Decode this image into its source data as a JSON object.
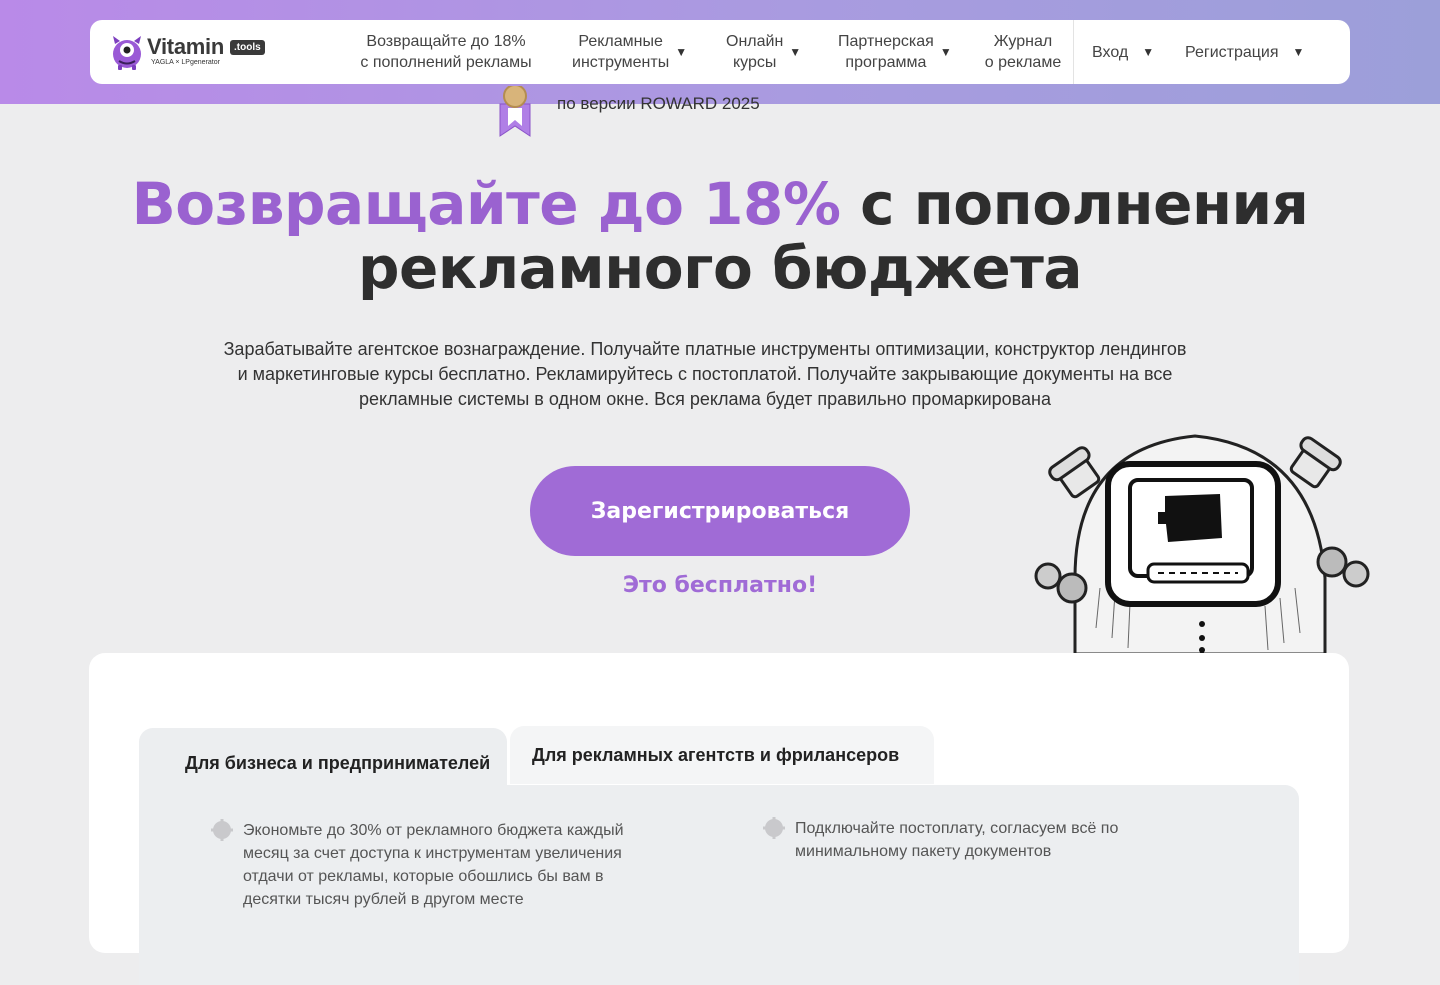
{
  "brand": {
    "name": "Vitamin",
    "tag": ".tools",
    "sub": "YAGLA × LPgenerator"
  },
  "nav": {
    "items": [
      {
        "line1": "Возвращайте до 18%",
        "line2": "с пополнений рекламы",
        "has_caret": false
      },
      {
        "line1": "Рекламные",
        "line2": "инструменты",
        "has_caret": true
      },
      {
        "line1": "Онлайн",
        "line2": "курсы",
        "has_caret": true
      },
      {
        "line1": "Партнерская",
        "line2": "программа",
        "has_caret": true
      },
      {
        "line1": "Журнал",
        "line2": "о рекламе",
        "has_caret": false
      }
    ],
    "login": "Вход",
    "register": "Регистрация",
    "caret_glyph": "▼"
  },
  "award": {
    "text": "по версии ROWARD 2025"
  },
  "hero": {
    "title_accent": "Возвращайте до 18%",
    "title_rest": " с пополнения рекламного бюджета",
    "subtitle": "Зарабатывайте агентское вознаграждение. Получайте платные инструменты оптимизации, конструктор лендингов и маркетинговые курсы бесплатно. Рекламируйтесь с постоплатой. Получайте закрывающие документы на все рекламные системы в одном окне. Вся реклама будет правильно промаркирована",
    "cta_label": "Зарегистрироваться",
    "free_note": "Это бесплатно!"
  },
  "tabs": {
    "items": [
      {
        "label": "Для бизнеса и предпринимателей",
        "active": true
      },
      {
        "label": "Для рекламных агентств и фрилансеров",
        "active": false
      }
    ]
  },
  "features": [
    "Экономьте до 30% от рекламного бюджета каждый месяц за счет доступа к инструментам увеличения отдачи от рекламы, которые обошлись бы вам в десятки тысяч рублей в другом месте",
    "Подключайте постоплату, согласуем всё по минимальному пакету документов"
  ],
  "colors": {
    "accent": "#a06bd6",
    "band_start": "#b98ae8",
    "band_end": "#9c9fd9",
    "page_bg": "#ededee"
  }
}
